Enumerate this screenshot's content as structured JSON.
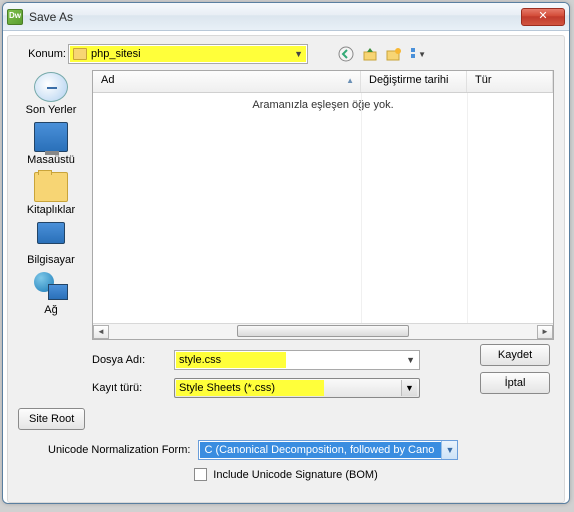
{
  "window": {
    "title": "Save As"
  },
  "toolbar": {
    "location_label": "Konum:",
    "location_value": "php_sitesi"
  },
  "sidebar": {
    "items": [
      {
        "label": "Son Yerler"
      },
      {
        "label": "Masaüstü"
      },
      {
        "label": "Kitaplıklar"
      },
      {
        "label": "Bilgisayar"
      },
      {
        "label": "Ağ"
      }
    ]
  },
  "columns": {
    "name": "Ad",
    "modified": "Değiştirme tarihi",
    "type": "Tür"
  },
  "list": {
    "empty_message": "Aramanızla eşleşen öğe yok."
  },
  "fields": {
    "filename_label": "Dosya Adı:",
    "filename_value": "style.css",
    "savetype_label": "Kayıt türü:",
    "savetype_value": "Style Sheets (*.css)"
  },
  "buttons": {
    "save": "Kaydet",
    "cancel": "İptal",
    "site_root": "Site Root"
  },
  "unicode": {
    "label": "Unicode Normalization Form:",
    "value": "C (Canonical Decomposition, followed by Cano",
    "checkbox_label": "Include Unicode Signature (BOM)"
  }
}
